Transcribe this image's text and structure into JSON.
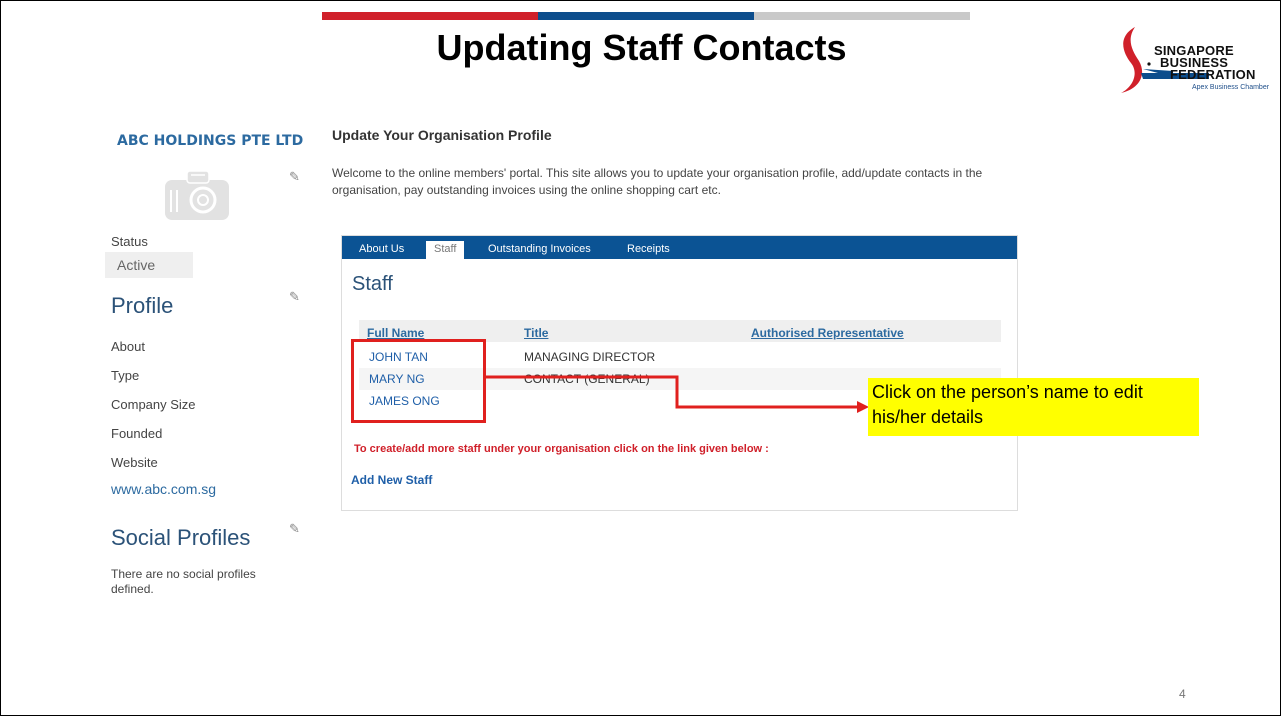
{
  "slide": {
    "title": "Updating Staff Contacts",
    "page_number": "4",
    "brand_colors": {
      "red": "#d0202a",
      "blue": "#0c4d8c",
      "grey": "#c9c9c9"
    }
  },
  "logo": {
    "line1": "SINGAPORE",
    "line2": "BUSINESS",
    "line3": "FEDERATION",
    "tagline": "Apex Business Chamber"
  },
  "sidebar": {
    "company_name": "ABC HOLDINGS PTE LTD",
    "status_label": "Status",
    "status_value": "Active",
    "profile_heading": "Profile",
    "profile_items": [
      "About",
      "Type",
      "Company Size",
      "Founded",
      "Website"
    ],
    "website": "www.abc.com.sg",
    "social_heading": "Social Profiles",
    "social_note": "There are no social profiles defined."
  },
  "main": {
    "heading": "Update Your Organisation Profile",
    "intro": "Welcome to the online members' portal. This site allows you to update your organisation profile, add/update contacts in the organisation, pay outstanding invoices using the online shopping cart etc."
  },
  "panel": {
    "tabs": [
      "About Us",
      "Staff",
      "Outstanding Invoices",
      "Receipts"
    ],
    "active_tab": "Staff",
    "heading": "Staff",
    "columns": [
      "Full Name",
      "Title",
      "Authorised Representative"
    ],
    "rows": [
      {
        "name": "JOHN TAN",
        "title": "MANAGING DIRECTOR",
        "authorised": ""
      },
      {
        "name": "MARY NG",
        "title": "CONTACT (GENERAL)",
        "authorised": ""
      },
      {
        "name": "JAMES ONG",
        "title": "",
        "authorised": ""
      }
    ],
    "note": "To create/add more staff under your organisation click on the link given below :",
    "add_staff": "Add New Staff"
  },
  "callout": {
    "text": "Click on the person’s name to edit his/her details",
    "highlight_color": "#e0201e",
    "background": "#ffff00"
  },
  "icons": [
    "camera-icon",
    "pencil-icon",
    "logo-swoosh-icon",
    "arrow-right-icon"
  ]
}
